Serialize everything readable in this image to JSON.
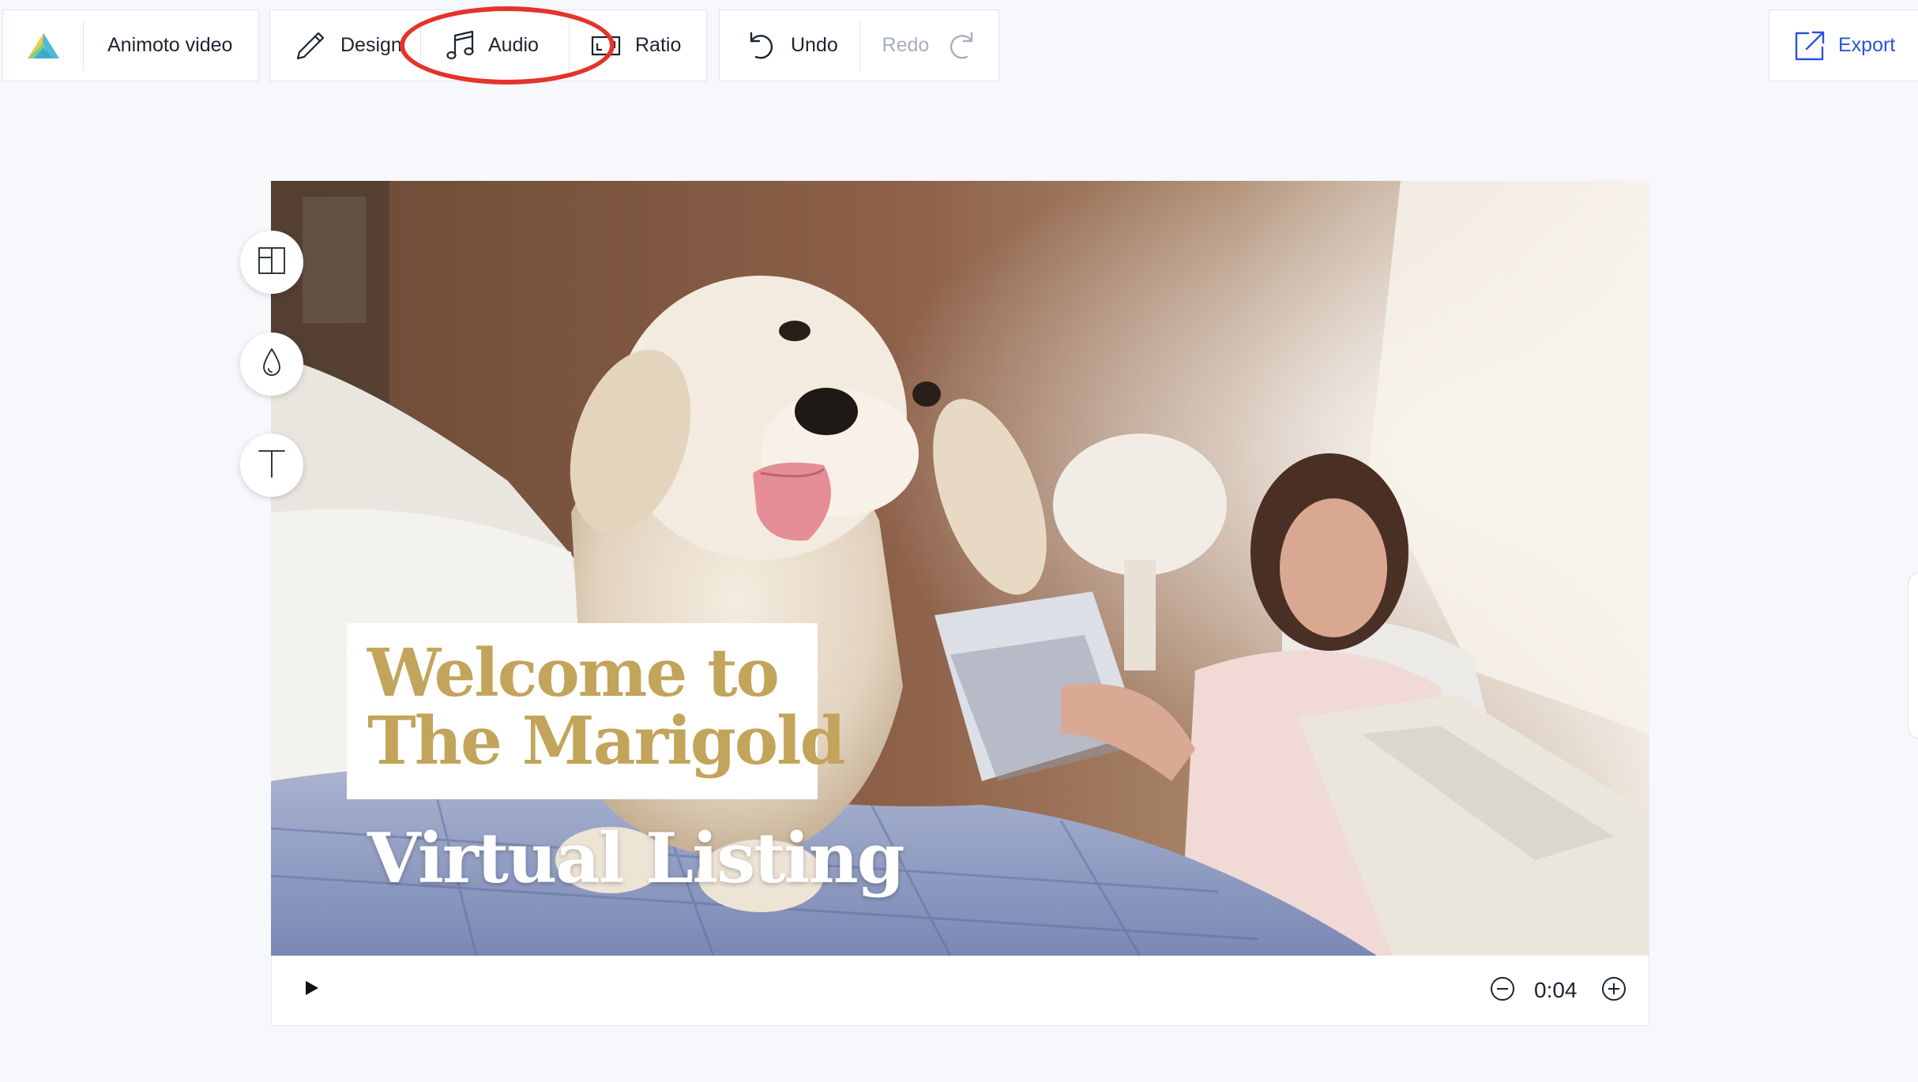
{
  "toolbar": {
    "project_title": "Animoto video",
    "design_label": "Design",
    "audio_label": "Audio",
    "ratio_label": "Ratio",
    "undo_label": "Undo",
    "redo_label": "Redo",
    "export_label": "Export"
  },
  "icons": {
    "logo": "animoto-logo-icon",
    "design": "pencil-icon",
    "audio": "music-note-icon",
    "ratio": "aspect-ratio-icon",
    "undo": "undo-arrow-icon",
    "redo": "redo-arrow-icon",
    "export": "export-arrow-icon",
    "side_layout": "layout-icon",
    "side_color": "color-drop-icon",
    "side_text": "text-icon",
    "play": "play-icon",
    "duration_minus": "minus-circle-icon",
    "duration_plus": "plus-circle-icon"
  },
  "canvas": {
    "title_line_1": "Welcome to",
    "title_line_2": "The Marigold",
    "subtitle": "Virtual Listing"
  },
  "playback": {
    "duration": "0:04"
  },
  "colors": {
    "background": "#f6f8fc",
    "accent_blue": "#2a54d8",
    "highlight_red": "#e3342b",
    "title_gold": "#c2a45a",
    "disabled_text": "#a7afbb"
  }
}
